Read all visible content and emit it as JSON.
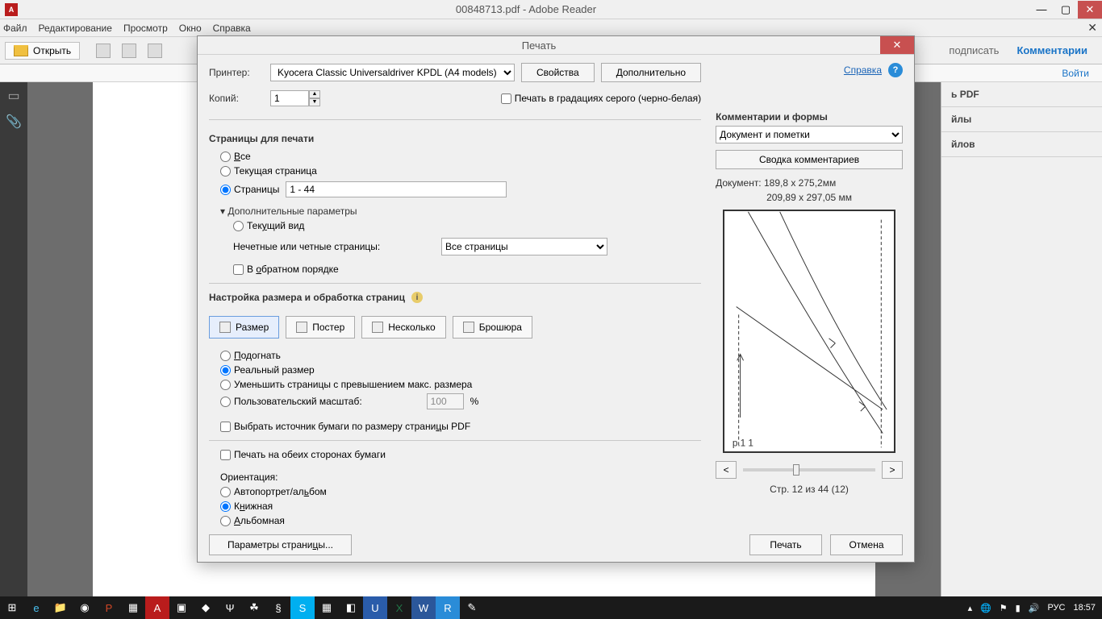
{
  "window": {
    "title": "00848713.pdf - Adobe Reader",
    "menu": [
      "Файл",
      "Редактирование",
      "Просмотр",
      "Окно",
      "Справка"
    ],
    "open_label": "Открыть",
    "right_links": {
      "sign": "подписать",
      "comments": "Комментарии"
    },
    "signin": "Войти"
  },
  "right_panel": {
    "i1": "ь PDF",
    "i2": "йлы",
    "i3": "йлов"
  },
  "dialog": {
    "title": "Печать",
    "help_link": "Справка",
    "printer_label": "Принтер:",
    "printer_value": "Kyocera Classic Universaldriver KPDL (A4 models)",
    "props_btn": "Свойства",
    "more_btn": "Дополнительно",
    "copies_label": "Копий:",
    "copies_value": "1",
    "grayscale_label": "Печать в градациях серого (черно-белая)",
    "pages_section": "Страницы для печати",
    "all": "Все",
    "current": "Текущая страница",
    "pages_radio": "Страницы",
    "pages_value": "1 - 44",
    "more_params": "Дополнительные параметры",
    "current_view": "Текущий вид",
    "odd_even_label": "Нечетные или четные страницы:",
    "odd_even_value": "Все страницы",
    "reverse": "В обратном порядке",
    "sizing_section": "Настройка размера и обработка страниц",
    "tabs": {
      "size": "Размер",
      "poster": "Постер",
      "multiple": "Несколько",
      "booklet": "Брошюра"
    },
    "fit": "Подогнать",
    "actual": "Реальный размер",
    "shrink": "Уменьшить страницы с превышением макс. размера",
    "custom_scale": "Пользовательский масштаб:",
    "scale_value": "100",
    "percent": "%",
    "paper_source": "Выбрать источник бумаги по размеру страницы PDF",
    "duplex": "Печать на обеих сторонах бумаги",
    "orientation_label": "Ориентация:",
    "orient_auto": "Автопортрет/альбом",
    "orient_portrait": "Книжная",
    "orient_landscape": "Альбомная",
    "page_setup_btn": "Параметры страницы...",
    "print_btn": "Печать",
    "cancel_btn": "Отмена",
    "comments_section": "Комментарии и формы",
    "comments_value": "Документ и пометки",
    "summary_btn": "Сводка комментариев",
    "doc_dim": "Документ: 189,8 x 275,2мм",
    "paper_dim": "209,89 x 297,05 мм",
    "page_of": "Стр. 12 из 44 (12)"
  },
  "taskbar": {
    "lang": "РУС",
    "time": "18:57"
  }
}
